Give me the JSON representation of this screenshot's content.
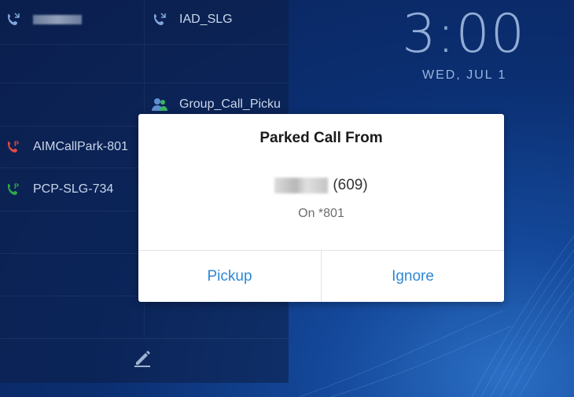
{
  "clock": {
    "time": "3:00",
    "date": "WED, JUL 1"
  },
  "line_keys": [
    {
      "label": "",
      "icon": "blf-call-icon",
      "redacted": true
    },
    {
      "label": "IAD_SLG",
      "icon": "blf-call-icon"
    },
    {
      "label": "Group_Call_Picku",
      "icon": "group-contact-icon"
    },
    {
      "label": "AIMCallPark-801",
      "icon": "parked-call-red-icon"
    },
    {
      "label": "PCP-SLG-734",
      "icon": "parked-call-green-icon"
    }
  ],
  "dialog": {
    "title": "Parked Call From",
    "caller_number": "(609)",
    "parked_on": "On *801",
    "pickup_label": "Pickup",
    "ignore_label": "Ignore"
  },
  "colors": {
    "accent": "#2e88d6",
    "blf_icon": "#7fa6dc",
    "red_icon": "#e04848",
    "green_icon": "#2ea84a"
  }
}
